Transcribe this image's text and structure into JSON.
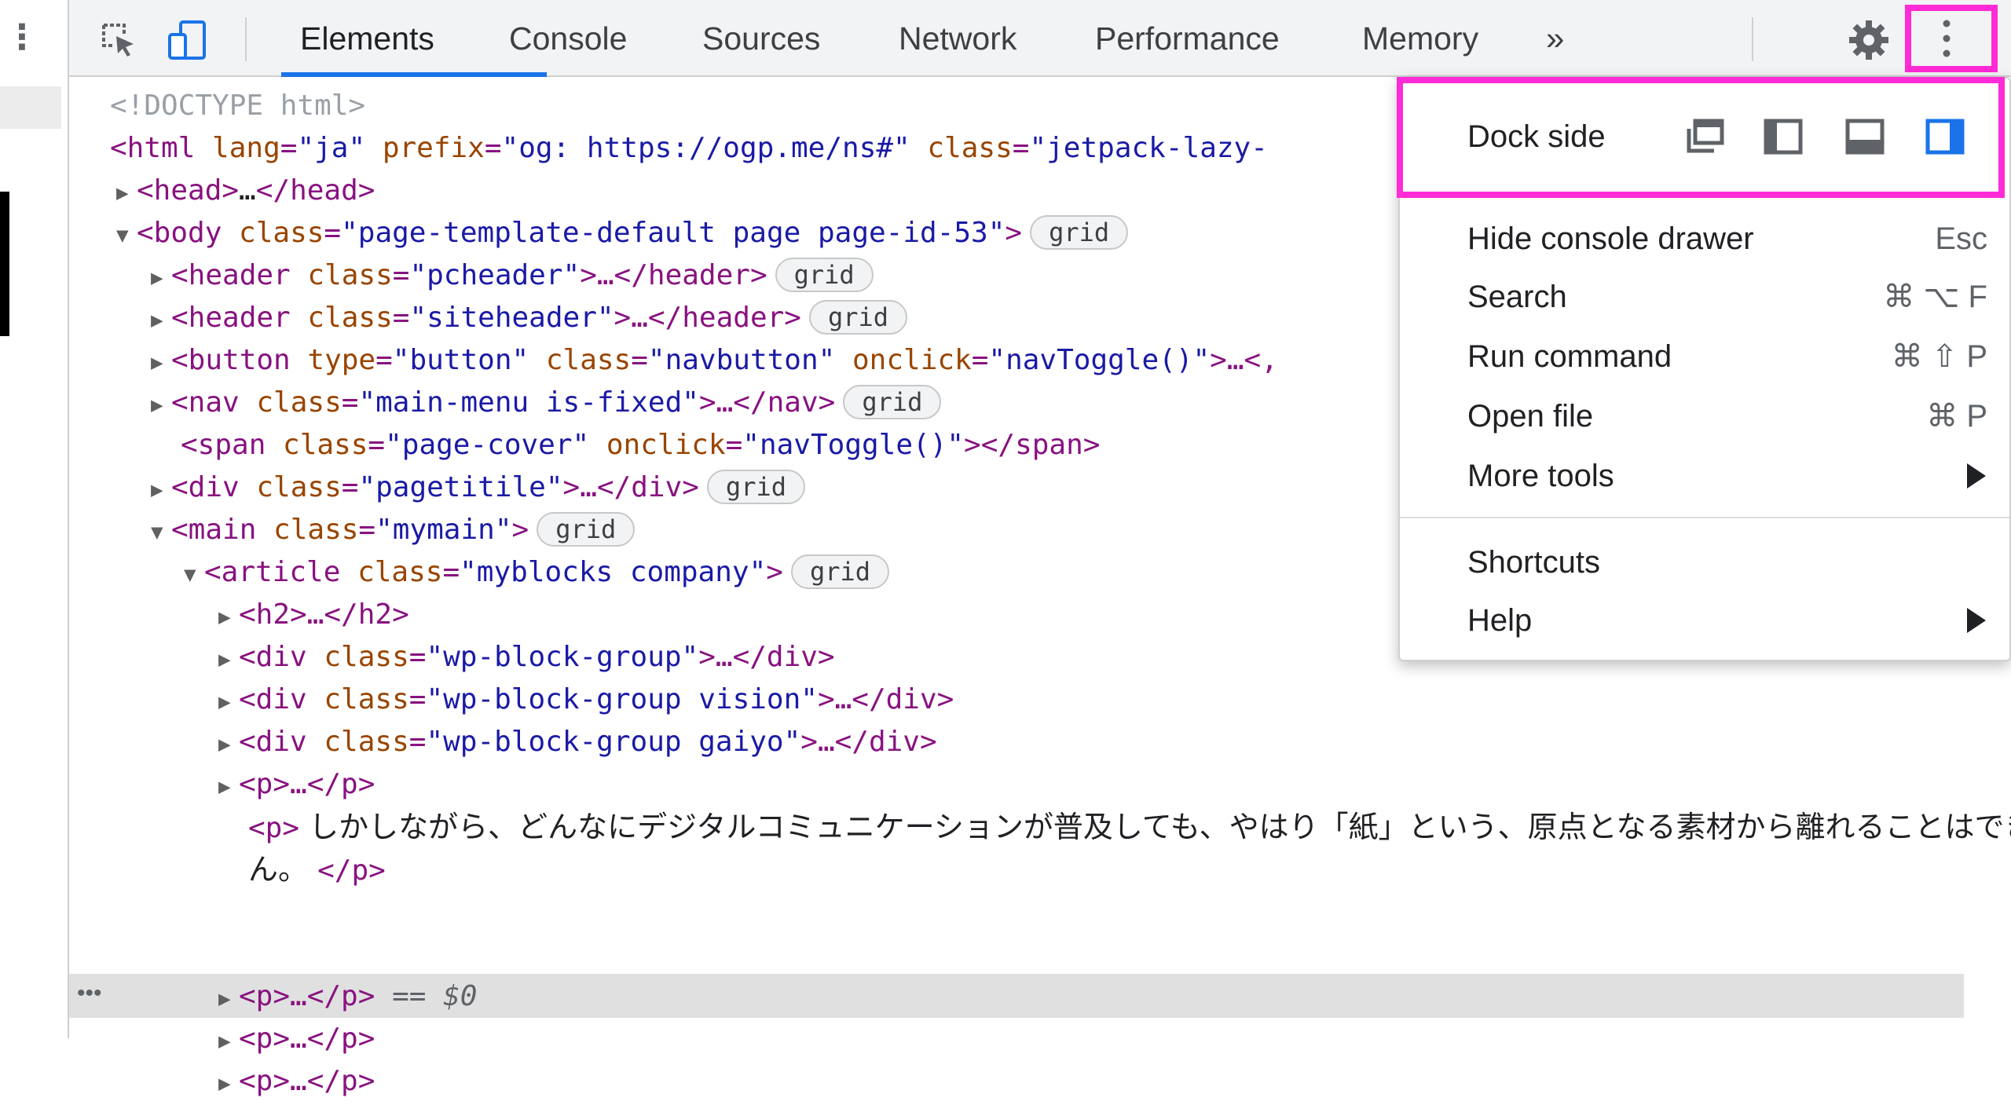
{
  "toolbar": {
    "tabs": [
      {
        "label": "Elements",
        "active": true
      },
      {
        "label": "Console",
        "active": false
      },
      {
        "label": "Sources",
        "active": false
      },
      {
        "label": "Network",
        "active": false
      },
      {
        "label": "Performance",
        "active": false
      },
      {
        "label": "Memory",
        "active": false
      }
    ],
    "more_tabs": "»",
    "icons": [
      "inspect-element-icon",
      "device-toggle-icon",
      "settings-gear-icon",
      "kebab-menu-icon",
      "close-icon"
    ],
    "accent_color": "#1a73e8",
    "highlight_color": "#ff2bd6"
  },
  "dom": {
    "doctype": "<!DOCTYPE html>",
    "html_open": {
      "tag": "<html",
      "a1": " lang",
      "v1": "\"ja\"",
      "a2": " prefix",
      "v2": "\"og: https://ogp.me/ns#\"",
      "a3": " class",
      "v3": "\"jetpack-lazy-"
    },
    "head": {
      "open": "<head>",
      "ell": "…",
      "close": "</head>"
    },
    "body_open": {
      "tag": "<body",
      "attr": " class",
      "val": "\"page-template-default page page-id-53\"",
      "end": ">",
      "badge": "grid"
    },
    "pcheader": {
      "tag": "<header",
      "attr": " class",
      "val": "\"pcheader\"",
      "end": ">…</header>",
      "badge": "grid"
    },
    "siteheader": {
      "tag": "<header",
      "attr": " class",
      "val": "\"siteheader\"",
      "end": ">…</header>",
      "badge": "grid"
    },
    "button": {
      "tag": "<button",
      "a1": " type",
      "v1": "\"button\"",
      "a2": " class",
      "v2": "\"navbutton\"",
      "a3": " onclick",
      "v3": "\"navToggle()\"",
      "end": ">…<,"
    },
    "nav": {
      "tag": "<nav",
      "attr": " class",
      "val": "\"main-menu is-fixed\"",
      "end": ">…</nav>",
      "badge": "grid"
    },
    "span": {
      "tag": "<span",
      "a1": " class",
      "v1": "\"page-cover\"",
      "a2": " onclick",
      "v2": "\"navToggle()\"",
      "end": "></span>"
    },
    "pagetitile": {
      "tag": "<div",
      "attr": " class",
      "val": "\"pagetitile\"",
      "end": ">…</div>",
      "badge": "grid"
    },
    "main": {
      "tag": "<main",
      "attr": " class",
      "val": "\"mymain\"",
      "end": ">",
      "badge": "grid"
    },
    "article": {
      "tag": "<article",
      "attr": " class",
      "val": "\"myblocks company\"",
      "end": ">",
      "badge": "grid"
    },
    "h2": "<h2>…</h2>",
    "div1": {
      "tag": "<div",
      "attr": " class",
      "val": "\"wp-block-group\"",
      "end": ">…</div>"
    },
    "div2": {
      "tag": "<div",
      "attr": " class",
      "val": "\"wp-block-group vision\"",
      "end": ">…</div>"
    },
    "div3": {
      "tag": "<div",
      "attr": " class",
      "val": "\"wp-block-group gaiyo\"",
      "end": ">…</div>"
    },
    "p1": "<p>…</p>",
    "p_text_open": "<p>",
    "p_text_line1": " しかしながら、どんなにデジタルコミュニケーションが普及しても、やはり「紙」という、原点となる素材から離れることはできませ",
    "p_text_line2": "ん。 ",
    "p_text_close": "</p>",
    "p_selected": "<p>…</p>",
    "p_selected_suffix": " == $0",
    "p3": "<p>…</p>",
    "p4": "<p>…</p>",
    "row_dots": "•••"
  },
  "menu": {
    "dock_side_label": "Dock side",
    "dock_options": [
      "undock-icon",
      "dock-left-icon",
      "dock-bottom-icon",
      "dock-right-icon"
    ],
    "dock_selected": "dock-right",
    "items": [
      {
        "label": "Hide console drawer",
        "shortcut": "Esc"
      },
      {
        "label": "Search",
        "shortcut": "⌘ ⌥ F"
      },
      {
        "label": "Run command",
        "shortcut": "⌘ ⇧ P"
      },
      {
        "label": "Open file",
        "shortcut": "⌘ P"
      },
      {
        "label": "More tools",
        "submenu": true
      }
    ],
    "items2": [
      {
        "label": "Shortcuts"
      },
      {
        "label": "Help",
        "submenu": true
      }
    ]
  }
}
